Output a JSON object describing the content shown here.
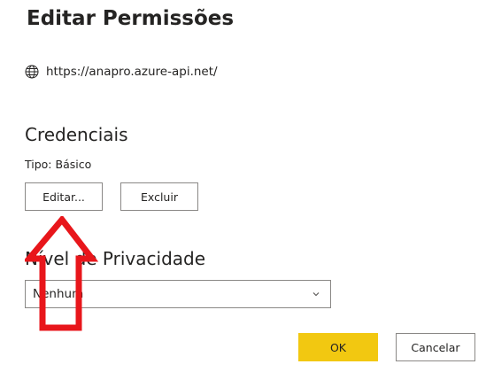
{
  "dialog": {
    "title": "Editar Permissões",
    "url": "https://anapro.azure-api.net/",
    "url_icon": "globe-icon"
  },
  "credentials": {
    "section_title": "Credenciais",
    "type_label": "Tipo: Básico",
    "edit_button": "Editar...",
    "delete_button": "Excluir"
  },
  "privacy": {
    "section_title": "Nível de Privacidade",
    "selected_value": "Nenhum",
    "caret_icon": "chevron-down-icon"
  },
  "footer": {
    "ok_button": "OK",
    "cancel_button": "Cancelar"
  },
  "annotation": {
    "arrow_color": "#e8161b",
    "arrow_icon": "red-arrow-annotation"
  },
  "colors": {
    "accent": "#f2c811",
    "text": "#252423",
    "border": "#8a8886"
  }
}
